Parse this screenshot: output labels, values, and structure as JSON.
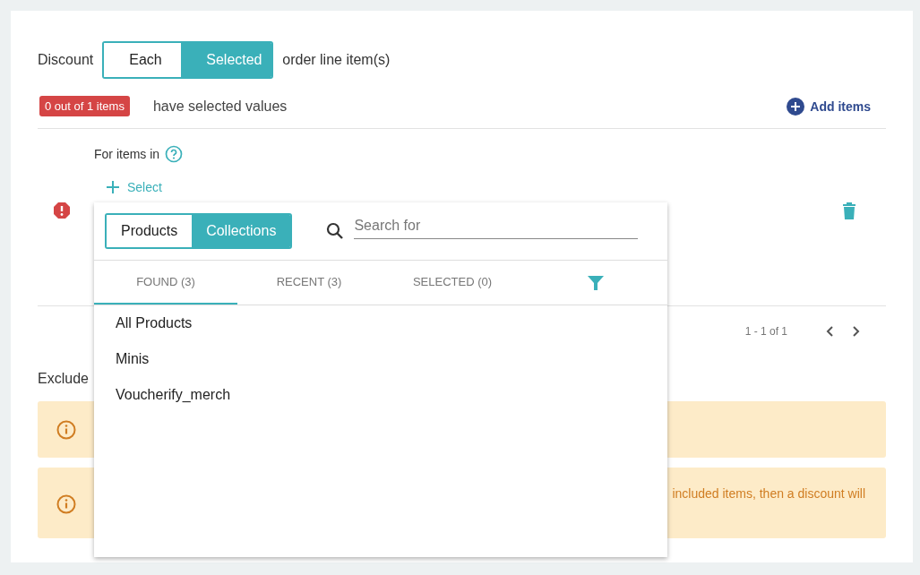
{
  "discount": {
    "label": "Discount",
    "options": [
      {
        "label": "Each",
        "selected": false
      },
      {
        "label": "Selected",
        "selected": true
      }
    ],
    "suffix": "order line item(s)"
  },
  "status": {
    "badge": "0 out of 1 items",
    "text": "have selected values"
  },
  "add_items": "Add items",
  "rule": {
    "label": "For items in",
    "select": "Select",
    "error": true
  },
  "pagination": {
    "range": "1 - 1 of 1"
  },
  "exclude_label": "Exclude",
  "warnings": [
    {
      "kind": "info"
    },
    {
      "kind": "info",
      "text": "included items, then a discount will"
    }
  ],
  "popup": {
    "types": [
      {
        "label": "Products",
        "selected": false
      },
      {
        "label": "Collections",
        "selected": true
      }
    ],
    "search": {
      "placeholder": "Search for"
    },
    "tabs": [
      {
        "label": "FOUND (3)",
        "selected": true
      },
      {
        "label": "RECENT (3)",
        "selected": false
      },
      {
        "label": "SELECTED (0)",
        "selected": false
      }
    ],
    "items": [
      "All Products",
      "Minis",
      "Voucherify_merch"
    ]
  }
}
